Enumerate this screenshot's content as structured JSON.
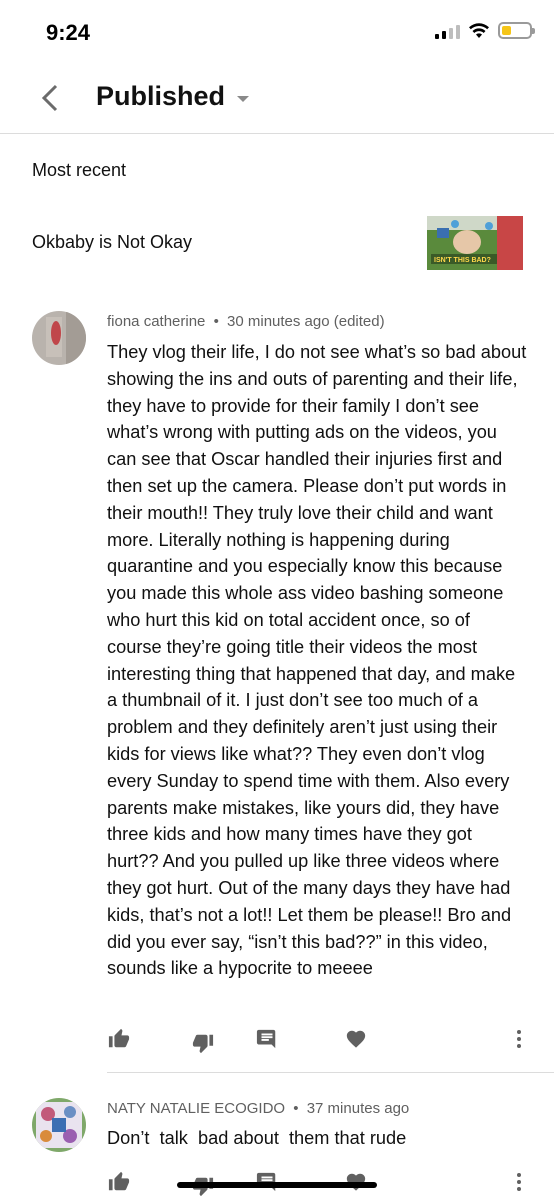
{
  "status_bar": {
    "time": "9:24",
    "battery_level": 0.35,
    "battery_color": "#f5c518"
  },
  "header": {
    "title": "Published"
  },
  "sort": {
    "label": "Most recent"
  },
  "video": {
    "title": "Okbaby is Not Okay",
    "thumbnail_text": "ISN'T THIS BAD?"
  },
  "comments": [
    {
      "author": "fiona catherine",
      "time": "30 minutes ago (edited)",
      "text": "They vlog their life, I do not see what’s so bad about showing the ins and outs of parenting and their life, they have to provide for their family I don’t see what’s wrong with putting ads on the videos, you can see that Oscar handled their injuries first and then set up the camera. Please don’t put words in their mouth!! They truly love their child and want more. Literally nothing is happening during quarantine and you especially know this because you made this whole ass video bashing someone who hurt this kid on total accident once, so of course they’re going title their videos the most interesting thing that happened that day, and make a thumbnail of it. I just don’t see too much of a problem and they definitely aren’t just using their kids for views like what?? They even don’t vlog every Sunday to spend time with them. Also every parents make mistakes, like yours did, they have three kids and how many times have they got hurt?? And you pulled up like three videos where they got hurt. Out of the many days they have had kids, that’s not a lot!! Let them be please!! Bro and did you ever say, “isn’t this bad??” in this video, sounds like a hypocrite to meeee"
    },
    {
      "author": "NATY NATALIE ECOGIDO",
      "time": "37 minutes ago",
      "text": "Don’t  talk  bad about  them that rude"
    }
  ],
  "separator": "•",
  "icons": [
    "back-chevron-icon",
    "dropdown-caret-icon",
    "thumbs-up-icon",
    "thumbs-down-icon",
    "reply-icon",
    "heart-icon",
    "more-vert-icon"
  ]
}
